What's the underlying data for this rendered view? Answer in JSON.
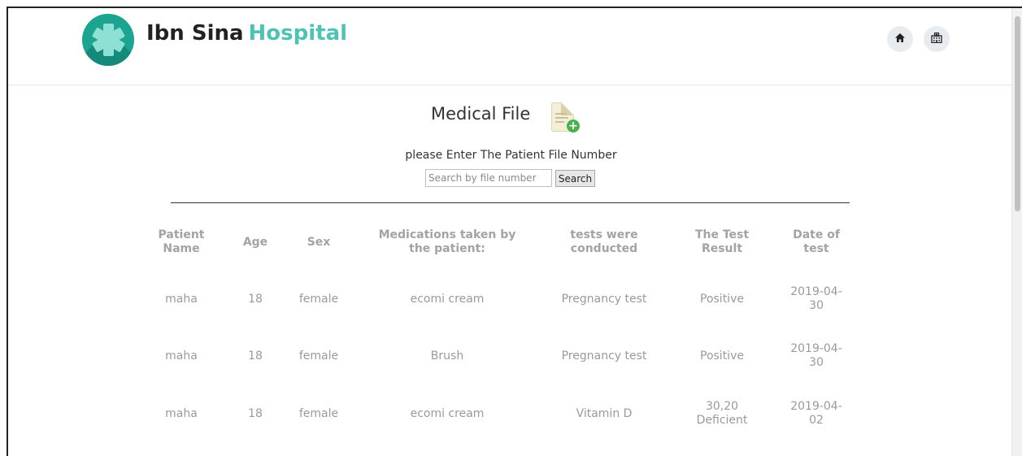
{
  "header": {
    "brand_first": "Ibn Sina",
    "brand_second": "Hospital",
    "nav_icons": [
      "home-icon",
      "hospital-icon"
    ],
    "colors": {
      "brand_accent": "#4fc3b3",
      "logo": "#1ba591"
    }
  },
  "main": {
    "title": "Medical File",
    "prompt": "please Enter The Patient File Number",
    "search": {
      "placeholder": "Search by file number",
      "value": "",
      "button_label": "Search"
    }
  },
  "table": {
    "headers": [
      "Patient Name",
      "Age",
      "Sex",
      "Medications taken by the patient:",
      "tests were conducted",
      "The Test Result",
      "Date of test"
    ],
    "rows": [
      [
        "maha",
        "18",
        "female",
        "ecomi cream",
        "Pregnancy test",
        "Positive",
        "2019-04-30"
      ],
      [
        "maha",
        "18",
        "female",
        "Brush",
        "Pregnancy test",
        "Positive",
        "2019-04-30"
      ],
      [
        "maha",
        "18",
        "female",
        "ecomi cream",
        "Vitamin D",
        "30,20 Deficient",
        "2019-04-02"
      ]
    ]
  }
}
